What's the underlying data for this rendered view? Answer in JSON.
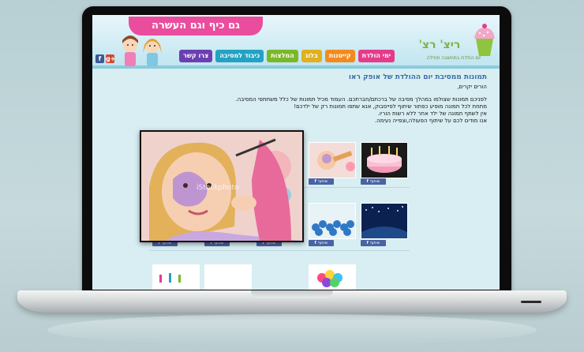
{
  "header": {
    "slogan": "גם כיף וגם העשרה",
    "logo_title": "ריצ' רצ'",
    "logo_tagline": "יום הולדת במחשבה תחילה"
  },
  "social": [
    {
      "name": "facebook-icon",
      "glyph": "f",
      "color": "#3b5998"
    },
    {
      "name": "google-plus-icon",
      "glyph": "g+",
      "color": "#d34836"
    }
  ],
  "nav": [
    {
      "label": "צרו קשר",
      "color": "#6c3fb0"
    },
    {
      "label": "כיבוד למסיבה",
      "color": "#23a2c4"
    },
    {
      "label": "המלצות",
      "color": "#7ab828"
    },
    {
      "label": "בלוג",
      "color": "#e0b01e"
    },
    {
      "label": "קייטנות",
      "color": "#f18a1f"
    },
    {
      "label": "ימי הולדת",
      "color": "#e43b8b"
    }
  ],
  "content": {
    "title": "תמונות ממסיבת יום ההולדת של אופק ראו",
    "greeting": "הורים יקרים,",
    "paragraphs": [
      "לפניכם תמונות שצולמו במהלך מסיבה של ברכתם/חברתכם. העמוד מכיל תמונות של כלל משתתפי המסיבה.",
      "מתחת לכל תמונה מופיע כפתור שיתוף לפייסבוק, אנא שתפו תמונות רק של ילדכם!",
      "אין לשתף תמונה של ילד אחר ללא רשות הוריו.",
      "אנו מודים לכם על שיתוף הפעולה,וצפייה נעימה."
    ]
  },
  "share_label": "שיתוף",
  "popup_watermark": "iStockphoto"
}
